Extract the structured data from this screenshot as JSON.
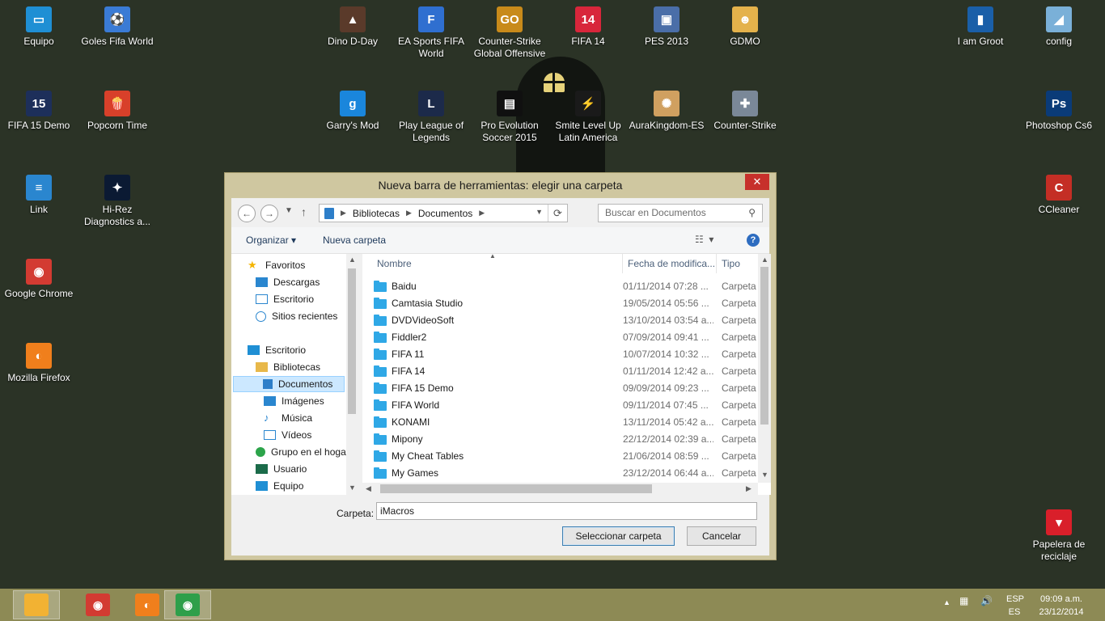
{
  "desktop": {
    "icons": [
      {
        "label": "Equipo",
        "icon": "computer-icon",
        "color": "#1f8fd4",
        "glyph": "▭"
      },
      {
        "label": "Goles Fifa World",
        "icon": "goles-fifa-icon",
        "color": "#3a7bd5",
        "glyph": "⚽"
      },
      {
        "label": "FIFA 15 Demo",
        "icon": "fifa15-icon",
        "color": "#1d2f5a",
        "glyph": "15"
      },
      {
        "label": "Popcorn Time",
        "icon": "popcorn-icon",
        "color": "#d8402a",
        "glyph": "🍿"
      },
      {
        "label": "Link",
        "icon": "document-icon",
        "color": "#2a86cf",
        "glyph": "≡"
      },
      {
        "label": "Hi-Rez Diagnostics a...",
        "icon": "hirez-icon",
        "color": "#0b1a33",
        "glyph": "✦"
      },
      {
        "label": "Google Chrome",
        "icon": "chrome-icon",
        "color": "#d33b32",
        "glyph": "◉"
      },
      {
        "label": "Mozilla Firefox",
        "icon": "firefox-icon",
        "color": "#f07f1c",
        "glyph": "◐"
      },
      {
        "label": "Dino D-Day",
        "icon": "dino-icon",
        "color": "#5a3a2a",
        "glyph": "▲"
      },
      {
        "label": "EA Sports FIFA World",
        "icon": "ea-fifa-icon",
        "color": "#2f6fd0",
        "glyph": "F"
      },
      {
        "label": "Counter-Strike Global Offensive",
        "icon": "csgo-icon",
        "color": "#c88a1a",
        "glyph": "GO"
      },
      {
        "label": "FIFA 14",
        "icon": "fifa14-icon",
        "color": "#d8263b",
        "glyph": "14"
      },
      {
        "label": "PES 2013",
        "icon": "pes2013-icon",
        "color": "#4a6ea8",
        "glyph": "▣"
      },
      {
        "label": "GDMO",
        "icon": "gdmo-icon",
        "color": "#e4b24b",
        "glyph": "☻"
      },
      {
        "label": "Garry's Mod",
        "icon": "gmod-icon",
        "color": "#1a86dc",
        "glyph": "g"
      },
      {
        "label": "Play League of Legends",
        "icon": "lol-icon",
        "color": "#1c2a4a",
        "glyph": "L"
      },
      {
        "label": "Pro Evolution Soccer 2015",
        "icon": "pes2015-icon",
        "color": "#101010",
        "glyph": "▤"
      },
      {
        "label": "Smite Level Up Latin America",
        "icon": "smite-icon",
        "color": "#1a1a1a",
        "glyph": "⚡"
      },
      {
        "label": "AuraKingdom-ES",
        "icon": "aurakingdom-icon",
        "color": "#d0a060",
        "glyph": "✺"
      },
      {
        "label": "Counter-Strike",
        "icon": "counterstrike-icon",
        "color": "#7a8898",
        "glyph": "✚"
      },
      {
        "label": "I am Groot",
        "icon": "groot-icon",
        "color": "#1a5fa8",
        "glyph": "▮"
      },
      {
        "label": "config",
        "icon": "config-icon",
        "color": "#7ab0d8",
        "glyph": "◢"
      },
      {
        "label": "Photoshop Cs6",
        "icon": "photoshop-icon",
        "color": "#0a3b78",
        "glyph": "Ps"
      },
      {
        "label": "CCleaner",
        "icon": "ccleaner-icon",
        "color": "#c42e25",
        "glyph": "C"
      },
      {
        "label": "Papelera de reciclaje",
        "icon": "recycle-bin-icon",
        "color": "#d91f2a",
        "glyph": "▾"
      }
    ]
  },
  "dialog": {
    "title": "Nueva barra de herramientas: elegir una carpeta",
    "close": "✕",
    "address": {
      "root": "Bibliotecas",
      "current": "Documentos"
    },
    "search_placeholder": "Buscar en Documentos",
    "toolbar": {
      "organize": "Organizar ▾",
      "new_folder": "Nueva carpeta"
    },
    "nav": {
      "favorites": "Favoritos",
      "downloads": "Descargas",
      "desktop_fav": "Escritorio",
      "recent": "Sitios recientes",
      "desktop": "Escritorio",
      "libraries": "Bibliotecas",
      "documents": "Documentos",
      "images": "Imágenes",
      "music": "Música",
      "videos": "Vídeos",
      "homegroup": "Grupo en el hoga",
      "user": "Usuario",
      "computer": "Equipo"
    },
    "columns": {
      "name": "Nombre",
      "date": "Fecha de modifica...",
      "type": "Tipo"
    },
    "files": [
      {
        "name": "Baidu",
        "date": "01/11/2014 07:28 ...",
        "type": "Carpeta"
      },
      {
        "name": "Camtasia Studio",
        "date": "19/05/2014 05:56 ...",
        "type": "Carpeta"
      },
      {
        "name": "DVDVideoSoft",
        "date": "13/10/2014 03:54 a...",
        "type": "Carpeta"
      },
      {
        "name": "Fiddler2",
        "date": "07/09/2014 09:41 ...",
        "type": "Carpeta"
      },
      {
        "name": "FIFA 11",
        "date": "10/07/2014 10:32 ...",
        "type": "Carpeta"
      },
      {
        "name": "FIFA 14",
        "date": "01/11/2014 12:42 a...",
        "type": "Carpeta"
      },
      {
        "name": "FIFA 15 Demo",
        "date": "09/09/2014 09:23 ...",
        "type": "Carpeta"
      },
      {
        "name": "FIFA World",
        "date": "09/11/2014 07:45 ...",
        "type": "Carpeta"
      },
      {
        "name": "KONAMI",
        "date": "13/11/2014 05:42 a...",
        "type": "Carpeta"
      },
      {
        "name": "Mipony",
        "date": "22/12/2014 02:39 a...",
        "type": "Carpeta"
      },
      {
        "name": "My Cheat Tables",
        "date": "21/06/2014 08:59 ...",
        "type": "Carpeta"
      },
      {
        "name": "My Games",
        "date": "23/12/2014 06:44 a...",
        "type": "Carpeta"
      }
    ],
    "folder_label": "Carpeta:",
    "folder_value": "iMacros",
    "select_button": "Seleccionar carpeta",
    "cancel_button": "Cancelar"
  },
  "taskbar": {
    "apps": [
      {
        "icon": "file-explorer-icon",
        "color": "#f2b233",
        "glyph": "",
        "active": true
      },
      {
        "icon": "chrome-icon",
        "color": "#d33b32",
        "glyph": "◉",
        "active": false
      },
      {
        "icon": "firefox-icon",
        "color": "#f07f1c",
        "glyph": "◐",
        "active": false
      },
      {
        "icon": "chrome-window-icon",
        "color": "#2e9f4a",
        "glyph": "◉",
        "active": true
      }
    ],
    "lang_top": "ESP",
    "lang_bottom": "ES",
    "time": "09:09 a.m.",
    "date": "23/12/2014"
  }
}
